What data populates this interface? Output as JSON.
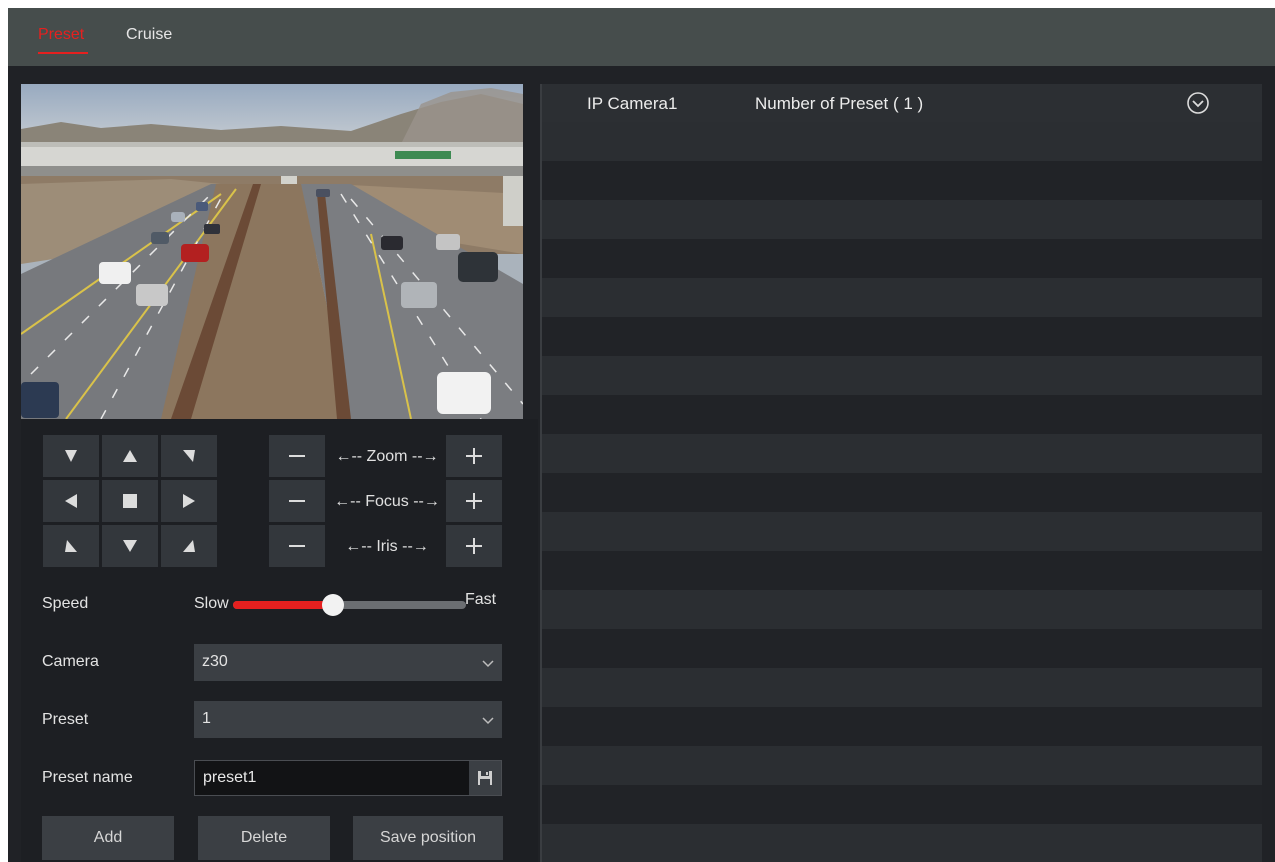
{
  "tabs": [
    {
      "label": "Preset",
      "active": true
    },
    {
      "label": "Cruise",
      "active": false
    }
  ],
  "ptz": {
    "zoom_label": "←-- Zoom --→",
    "focus_label": "←-- Focus --→",
    "iris_label": "←--  Iris  --→"
  },
  "form": {
    "speed_label": "Speed",
    "speed_slow": "Slow",
    "speed_fast": "Fast",
    "speed_value": 0.43,
    "camera_label": "Camera",
    "camera_value": "z30",
    "preset_label": "Preset",
    "preset_value": "1",
    "preset_name_label": "Preset name",
    "preset_name_value": "preset1"
  },
  "actions": {
    "add": "Add",
    "delete": "Delete",
    "save_position": "Save position"
  },
  "list": {
    "camera": "IP Camera1",
    "number_of_preset": "Number of Preset ( 1 )"
  },
  "colors": {
    "accent": "#e5201f",
    "topbar": "#464d4c",
    "panel": "#202226"
  },
  "icons": {
    "dpad": [
      "arrow-up-left-icon",
      "arrow-up-icon",
      "arrow-up-right-icon",
      "arrow-left-icon",
      "stop-icon",
      "arrow-right-icon",
      "arrow-down-left-icon",
      "arrow-down-icon",
      "arrow-down-right-icon"
    ],
    "save": "floppy-disk-icon",
    "expand": "chevron-circle-down-icon"
  }
}
